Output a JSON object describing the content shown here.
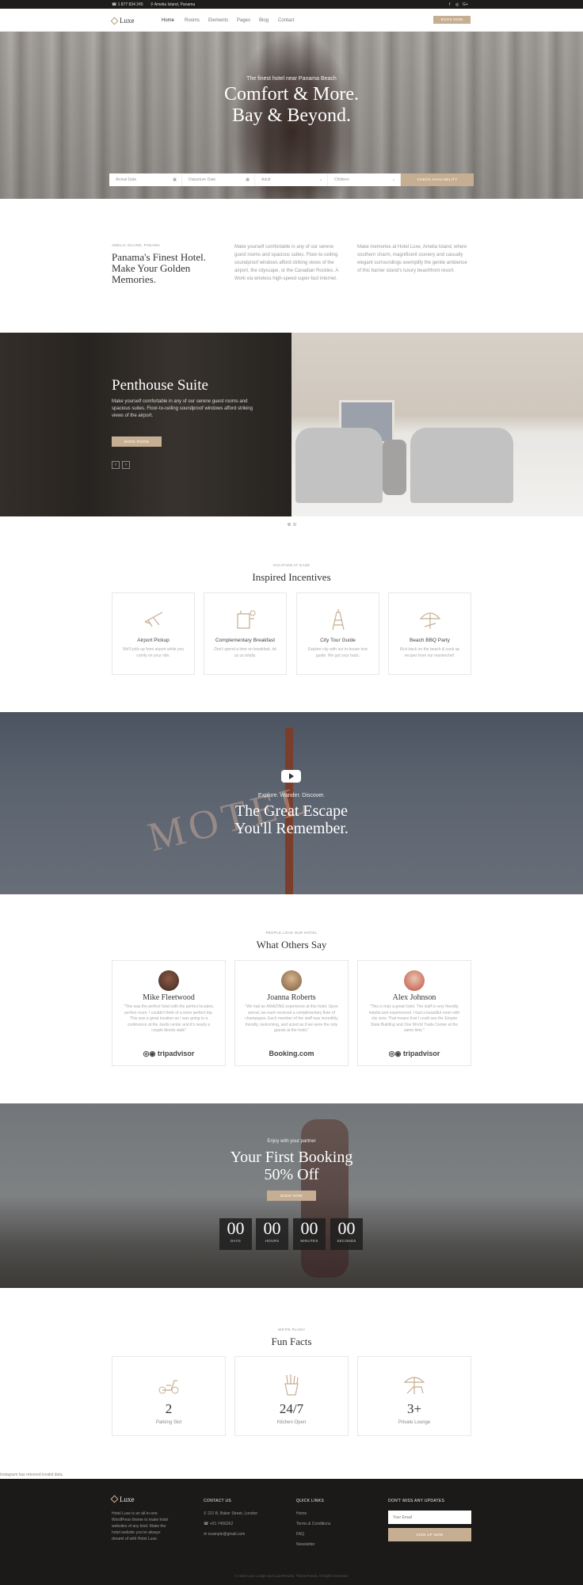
{
  "topbar": {
    "phone": "1 877 834 245",
    "location": "Amelia Island, Panama",
    "social": [
      "f",
      "◎",
      "G+"
    ]
  },
  "nav": {
    "brand": "Luxe",
    "items": [
      "Home",
      "Rooms",
      "Elements",
      "Pages",
      "Blog",
      "Contact"
    ],
    "book_now": "BOOK NOW"
  },
  "hero": {
    "subtitle": "The finest hotel near Panama Beach",
    "title_line1": "Comfort & More.",
    "title_line2": "Bay & Beyond.",
    "arrival_placeholder": "Arrival Date",
    "departure_placeholder": "Departure Date",
    "adult": "Adult",
    "children": "Children",
    "check_button": "CHECK AVAILABILITY"
  },
  "intro": {
    "eyebrow": "AMELIA ISLAND, PANAMA",
    "title": "Panama's Finest Hotel. Make Your Golden Memories.",
    "col1": "Make yourself comfortable in any of our serene guest rooms and spacious suites. Floor-to-ceiling soundproof windows afford striking views of the airport, the cityscape, or the Canadian Rockies. A Work via wireless high-speed super-fast internet.",
    "col2": "Make memories at Hotel Luxe, Amelia Island, where southern charm, magnificent scenery and casually elegant surroundings exemplify the gentle ambience of this barrier island's luxury beachfront resort."
  },
  "penthouse": {
    "title": "Penthouse Suite",
    "desc": "Make yourself comfortable in any of our serene guest rooms and spacious suites. Floor-to-ceiling soundproof windows afford striking views of the airport.",
    "button": "BOOK ROOM",
    "prev": "‹",
    "next": "›"
  },
  "incentives": {
    "eyebrow": "VACATION AT EASE",
    "title": "Inspired Incentives",
    "cards": [
      {
        "icon": "airplane-icon",
        "title": "Airport Pickup",
        "text": "We'll pick up from airport while you comfy on your ride."
      },
      {
        "icon": "breakfast-icon",
        "title": "Complementary Breakfast",
        "text": "Don't spend a time on breakfast, let us us totally."
      },
      {
        "icon": "eiffel-tower-icon",
        "title": "City Tour Guide",
        "text": "Explore city with our in-house tour guide. We got your back."
      },
      {
        "icon": "beach-umbrella-icon",
        "title": "Beach BBQ Party",
        "text": "Kick back on the beach & cook up recipes from our masterchef."
      }
    ]
  },
  "escape": {
    "subtitle": "Explore. Wander. Discover.",
    "title_line1": "The Great Escape",
    "title_line2": "You'll Remember.",
    "sign": "MOTEL"
  },
  "testimonials": {
    "eyebrow": "PEOPLE LOVE OUR HOTEL",
    "title": "What Others Say",
    "items": [
      {
        "name": "Mike Fleetwood",
        "quote": "\"This was the perfect hotel with the perfect location, perfect room. I couldn't think of a more perfect trip. This was a great location as I was going to a conference at the Javits center and it's nearly a couple blocks walk\"",
        "source": "tripadvisor"
      },
      {
        "name": "Joanna Roberts",
        "quote": "\"We had an AMAZING experience at this hotel. Upon arrival, we each received a complimentary flute of champagne. Each member of the staff was incredibly friendly, welcoming, and acted as if we were the only guests at the hotel.\"",
        "source": "Booking.com"
      },
      {
        "name": "Alex Johnson",
        "quote": "\"This is truly a great hotel. The staff is very friendly, helpful and experienced. I had a beautiful room with city view. That means that I could see the Empire State Building and One World Trade Center at the same time.\"",
        "source": "tripadvisor"
      }
    ]
  },
  "promo": {
    "subtitle": "Enjoy with your partner",
    "title_line1": "Your First Booking",
    "title_line2": "50% Off",
    "button": "BOOK NOW",
    "countdown": [
      {
        "value": "00",
        "label": "DAYS"
      },
      {
        "value": "00",
        "label": "HOURS"
      },
      {
        "value": "00",
        "label": "MINUTES"
      },
      {
        "value": "00",
        "label": "SECONDS"
      }
    ]
  },
  "facts": {
    "eyebrow": "WE'RE PLUSH",
    "title": "Fun Facts",
    "items": [
      {
        "icon": "scooter-icon",
        "value": "2",
        "label": "Parking Slot"
      },
      {
        "icon": "fries-icon",
        "value": "24/7",
        "label": "Kitchen Open"
      },
      {
        "icon": "beach-chair-icon",
        "value": "3+",
        "label": "Private Lounge"
      }
    ]
  },
  "instagram_error": "Instagram has returned invalid data.",
  "footer": {
    "brand": "Luxe",
    "about": "Hotel Luxe is an all-in-one WordPress theme to make hotel websites of any kind. Make the hotel website you've always dreamt of with Hotel Luxe.",
    "contact_head": "CONTACT US",
    "address": "221 B, Baker Street, London",
    "phone": "+01-7456262",
    "email": "example@gmail.com",
    "links_head": "QUICK LINKS",
    "links": [
      "Home",
      "Terms & Conditions",
      "FAQ",
      "Newsletter"
    ],
    "updates_head": "DON'T MISS ANY UPDATES",
    "email_placeholder": "Your Email",
    "signup": "SIGN UP NOW",
    "copyright": "© Hotel Luxe Lodge and LuxeResorts. ThemeForest. All rights reserved."
  },
  "colors": {
    "accent": "#c6ae92",
    "dark": "#1b1a19"
  }
}
